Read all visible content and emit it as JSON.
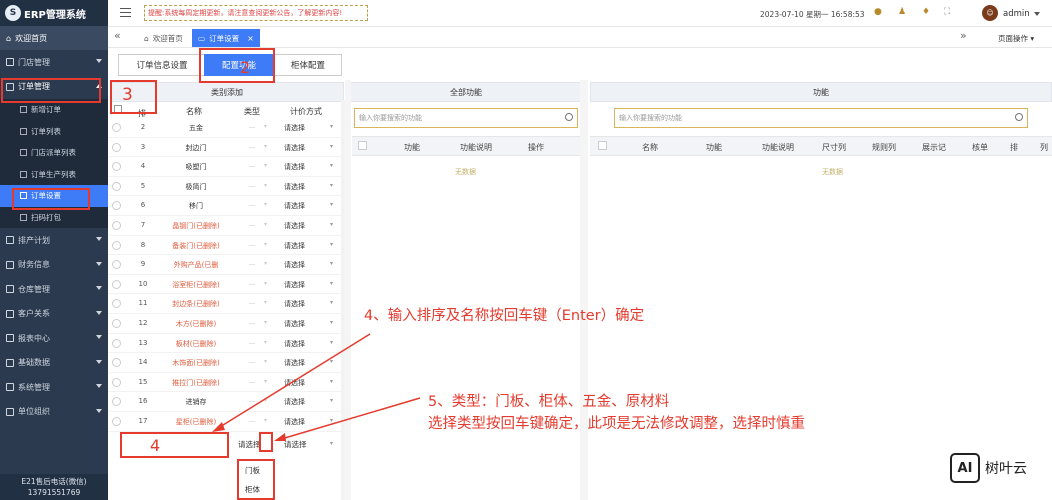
{
  "app": {
    "title": "ERP管理系统",
    "logo_glyph": "S"
  },
  "sidebar": {
    "home": "欢迎首页",
    "items": [
      {
        "label": "门店管理"
      },
      {
        "label": "订单管理"
      },
      {
        "label": "排产计划"
      },
      {
        "label": "财务信息"
      },
      {
        "label": "仓库管理"
      },
      {
        "label": "客户关系"
      },
      {
        "label": "报表中心"
      },
      {
        "label": "基础数据"
      },
      {
        "label": "系统管理"
      },
      {
        "label": "单位组织"
      }
    ],
    "sub_items": [
      {
        "label": "新增订单"
      },
      {
        "label": "订单列表"
      },
      {
        "label": "门店派单列表"
      },
      {
        "label": "订单生产列表"
      },
      {
        "label": "订单设置"
      },
      {
        "label": "扫码打包"
      }
    ],
    "footer_line1": "E21售后电话(微信)",
    "footer_line2": "13791551769"
  },
  "topbar": {
    "notice": "提醒:系统每周定期更新，请注意查阅更新公告，了解更新内容!",
    "date": "2023-07-10  星期一  16:58:53",
    "user": "admin"
  },
  "tabs": {
    "home": "欢迎首页",
    "order_settings": "订单设置",
    "close": "×",
    "collapse": "«",
    "expand": "»",
    "page_ops": "页面操作"
  },
  "subtabs": [
    "订单信息设置",
    "配置功能",
    "柜体配置"
  ],
  "left_panel": {
    "title": "类别添加",
    "headers": {
      "sort": "排",
      "name": "名称",
      "type": "类型",
      "pricing": "计价方式"
    },
    "rows": [
      {
        "num": "2",
        "name": "五金",
        "deleted": false
      },
      {
        "num": "3",
        "name": "封边门",
        "deleted": false
      },
      {
        "num": "4",
        "name": "吸塑门",
        "deleted": false
      },
      {
        "num": "5",
        "name": "极简门",
        "deleted": false
      },
      {
        "num": "6",
        "name": "移门",
        "deleted": false
      },
      {
        "num": "7",
        "name": "晶钢门(已删除)",
        "deleted": true
      },
      {
        "num": "8",
        "name": "备装门(已删除)",
        "deleted": true
      },
      {
        "num": "9",
        "name": "外购产品(已删",
        "deleted": true
      },
      {
        "num": "10",
        "name": "浴室柜(已删除)",
        "deleted": true
      },
      {
        "num": "11",
        "name": "封边条(已删除)",
        "deleted": true
      },
      {
        "num": "12",
        "name": "木方(已删除)",
        "deleted": true
      },
      {
        "num": "13",
        "name": "板材(已删除)",
        "deleted": true
      },
      {
        "num": "14",
        "name": "木饰面(已删除)",
        "deleted": true
      },
      {
        "num": "15",
        "name": "推拉门(已删除)",
        "deleted": true
      },
      {
        "num": "16",
        "name": "进销存",
        "deleted": false
      },
      {
        "num": "17",
        "name": "星柜(已删除)",
        "deleted": true
      }
    ],
    "pricing_default": "请选择",
    "new_row_type": "请选择",
    "new_row_pricing": "请选择",
    "dropdown_options": [
      "门板",
      "柜体"
    ]
  },
  "middle_panel": {
    "title": "全部功能",
    "search_placeholder": "输入你要搜索的功能",
    "headers": [
      "功能",
      "功能说明",
      "操作"
    ],
    "empty": "无数据"
  },
  "right_panel": {
    "title": "功能",
    "search_placeholder": "输入你要搜索的功能",
    "headers": [
      "名称",
      "功能",
      "功能说明",
      "尺寸列",
      "规则列",
      "展示记",
      "核单",
      "排",
      "列"
    ],
    "empty": "无数据"
  },
  "annotations": {
    "step2": "2",
    "step3": "3",
    "step4_label": "4",
    "step4_text": "4、输入排序及名称按回车键（Enter）确定",
    "step5_line1": "5、类型：门板、柜体、五金、原材料",
    "step5_line2": "选择类型按回车键确定，此项是无法修改调整，选择时慎重"
  },
  "watermark": {
    "box": "AI",
    "text": "树叶云"
  },
  "colors": {
    "sidebar": "#2b3a4e",
    "accent": "#3d7bf7",
    "annotation": "#e53b2e"
  }
}
